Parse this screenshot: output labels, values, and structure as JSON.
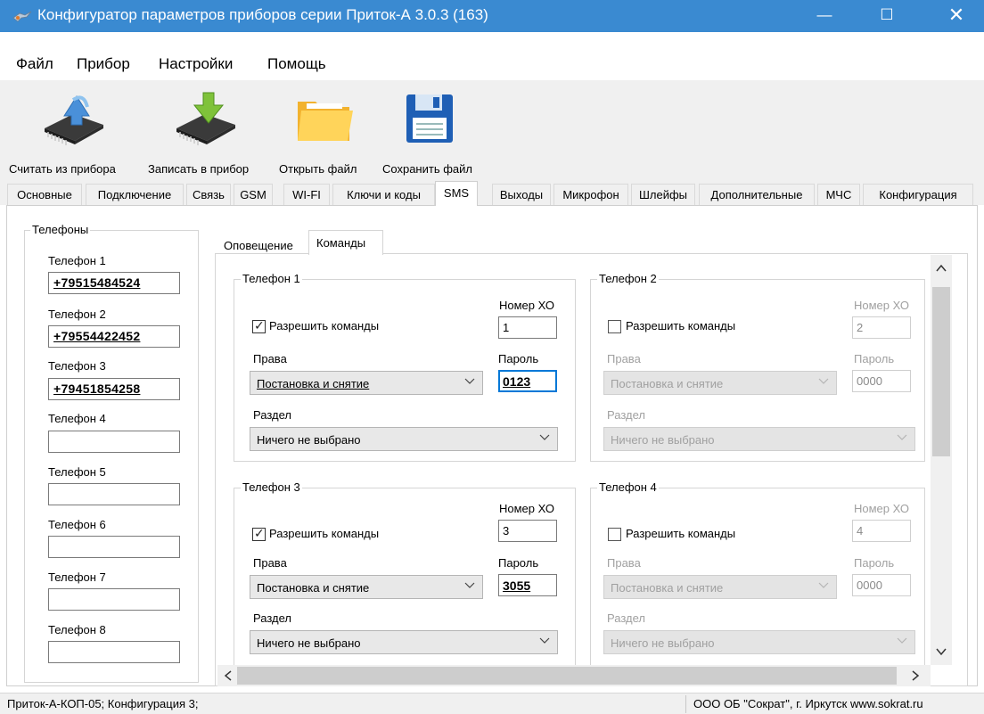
{
  "window": {
    "title": "Конфигуратор параметров приборов серии Приток-А   3.0.3 (163)",
    "min": "—",
    "max": "☐",
    "close": "✕"
  },
  "menu": [
    "Файл",
    "Прибор",
    "Настройки",
    "Помощь"
  ],
  "toolbar": {
    "read": "Считать из прибора",
    "write": "Записать в прибор",
    "open": "Открыть файл",
    "save": "Сохранить файл"
  },
  "tabs": [
    "Основные",
    "Подключение",
    "Связь",
    "GSM",
    "WI-FI",
    "Ключи и коды",
    "SMS",
    "Выходы",
    "Микрофон",
    "Шлейфы",
    "Дополнительные",
    "МЧС",
    "Конфигурация"
  ],
  "active_tab": "SMS",
  "phones_panel": {
    "title": "Телефоны",
    "items": [
      {
        "label": "Телефон 1",
        "value": "+79515484524"
      },
      {
        "label": "Телефон 2",
        "value": "+79554422452"
      },
      {
        "label": "Телефон 3",
        "value": "+79451854258"
      },
      {
        "label": "Телефон 4",
        "value": ""
      },
      {
        "label": "Телефон 5",
        "value": ""
      },
      {
        "label": "Телефон 6",
        "value": ""
      },
      {
        "label": "Телефон 7",
        "value": ""
      },
      {
        "label": "Телефон 8",
        "value": ""
      }
    ]
  },
  "subtabs": {
    "notify": "Оповещение",
    "commands": "Команды"
  },
  "labels": {
    "allow": "Разрешить команды",
    "hx": "Номер ХО",
    "rights": "Права",
    "password": "Пароль",
    "section": "Раздел"
  },
  "command_groups": [
    {
      "title": "Телефон 1",
      "allow": true,
      "hx": "1",
      "rights": "Постановка и снятие",
      "password": "0123",
      "section": "Ничего не выбрано"
    },
    {
      "title": "Телефон 2",
      "allow": false,
      "hx": "2",
      "rights": "Постановка и снятие",
      "password": "0000",
      "section": "Ничего не выбрано"
    },
    {
      "title": "Телефон 3",
      "allow": true,
      "hx": "3",
      "rights": "Постановка и снятие",
      "password": "3055",
      "section": "Ничего не выбрано"
    },
    {
      "title": "Телефон 4",
      "allow": false,
      "hx": "4",
      "rights": "Постановка и снятие",
      "password": "0000",
      "section": "Ничего не выбрано"
    }
  ],
  "status": {
    "left": "Приток-А-КОП-05; Конфигурация 3;",
    "right": "ООО ОБ \"Сократ\", г. Иркутск   www.sokrat.ru"
  }
}
